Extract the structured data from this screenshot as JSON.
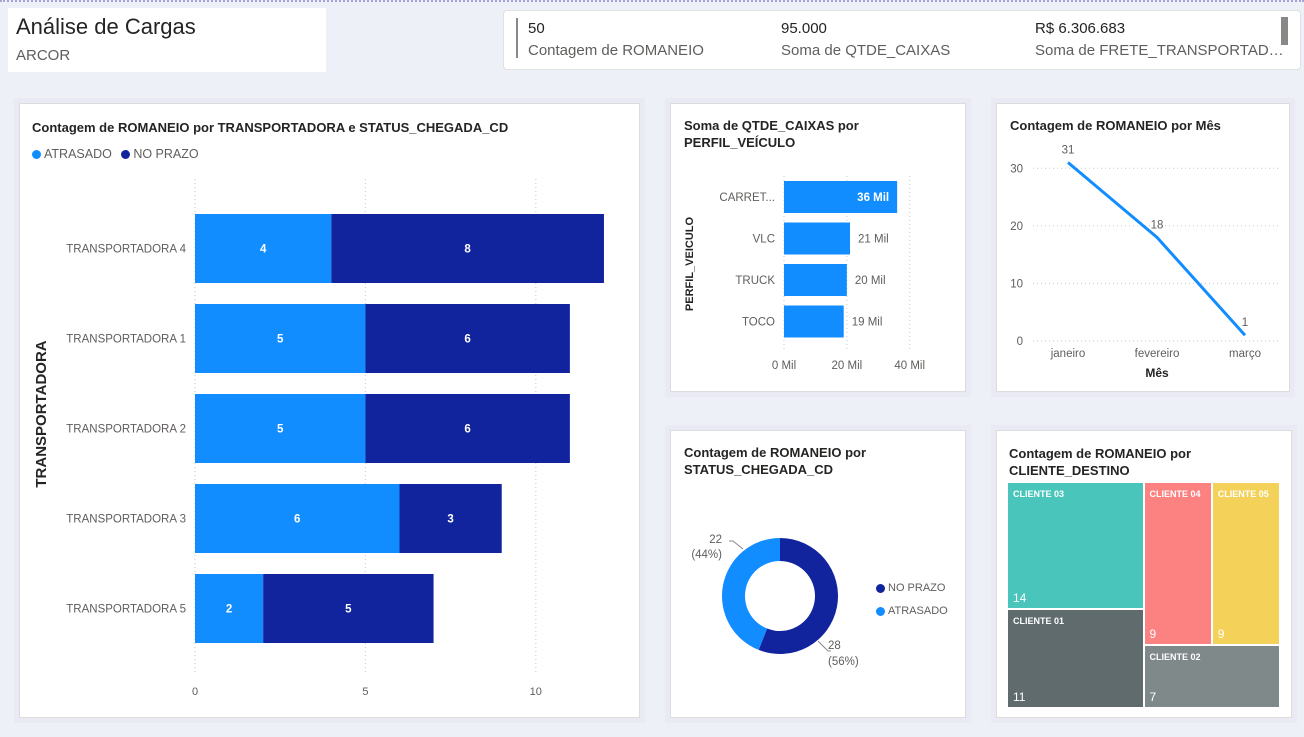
{
  "header": {
    "title": "Análise de Cargas",
    "subtitle": "ARCOR"
  },
  "kpis": [
    {
      "value": "50",
      "label": "Contagem de ROMANEIO"
    },
    {
      "value": "95.000",
      "label": "Soma de QTDE_CAIXAS"
    },
    {
      "value": "R$ 6.306.683",
      "label": "Soma de FRETE_TRANSPORTADORA"
    }
  ],
  "colors": {
    "atrasado": "#118dff",
    "no_prazo": "#12239e",
    "line": "#118dff"
  },
  "chart_data": [
    {
      "id": "bar_transportadora",
      "type": "bar",
      "orientation": "horizontal",
      "stacked": true,
      "title": "Contagem de ROMANEIO por TRANSPORTADORA e STATUS_CHEGADA_CD",
      "ylabel": "TRANSPORTADORA",
      "xlabel": "",
      "categories": [
        "TRANSPORTADORA 4",
        "TRANSPORTADORA 1",
        "TRANSPORTADORA 2",
        "TRANSPORTADORA 3",
        "TRANSPORTADORA 5"
      ],
      "series": [
        {
          "name": "ATRASADO",
          "values": [
            4,
            5,
            5,
            6,
            2
          ]
        },
        {
          "name": "NO PRAZO",
          "values": [
            8,
            6,
            6,
            3,
            5
          ]
        }
      ],
      "xticks": [
        "0",
        "5",
        "10"
      ],
      "xlim": [
        0,
        12.5
      ],
      "legend": "top-left",
      "grid": true
    },
    {
      "id": "bar_perfil",
      "type": "bar",
      "orientation": "horizontal",
      "title": "Soma de QTDE_CAIXAS por PERFIL_VEÍCULO",
      "ylabel": "PERFIL_VEICULO",
      "categories": [
        "CARRET...",
        "VLC",
        "TRUCK",
        "TOCO"
      ],
      "values": [
        36,
        21,
        20,
        19
      ],
      "value_labels": [
        "36 Mil",
        "21 Mil",
        "20 Mil",
        "19 Mil"
      ],
      "xticks": [
        "0 Mil",
        "20 Mil",
        "40 Mil"
      ],
      "xlim": [
        0,
        42
      ]
    },
    {
      "id": "line_mes",
      "type": "line",
      "title": "Contagem de ROMANEIO por Mês",
      "xlabel": "Mês",
      "x": [
        "janeiro",
        "fevereiro",
        "março"
      ],
      "values": [
        31,
        18,
        1
      ],
      "value_labels": [
        "31",
        "18",
        "1"
      ],
      "yticks": [
        "0",
        "10",
        "20",
        "30"
      ],
      "ylim": [
        0,
        33
      ],
      "grid": true
    },
    {
      "id": "donut_status",
      "type": "pie",
      "donut": true,
      "title": "Contagem de ROMANEIO por STATUS_CHEGADA_CD",
      "slices": [
        {
          "name": "NO PRAZO",
          "value": 28,
          "label": "28",
          "pct": "(56%)"
        },
        {
          "name": "ATRASADO",
          "value": 22,
          "label": "22",
          "pct": "(44%)"
        }
      ],
      "legend": "right"
    },
    {
      "id": "treemap_cliente",
      "type": "treemap",
      "title": "Contagem de ROMANEIO por CLIENTE_DESTINO",
      "items": [
        {
          "name": "CLIENTE 03",
          "value": 14,
          "color": "#4ac5bb"
        },
        {
          "name": "CLIENTE 01",
          "value": 11,
          "color": "#5f6b6d"
        },
        {
          "name": "CLIENTE 04",
          "value": 9,
          "color": "#fb8281"
        },
        {
          "name": "CLIENTE 05",
          "value": 9,
          "color": "#f4d25a"
        },
        {
          "name": "CLIENTE 02",
          "value": 7,
          "color": "#7f898a"
        }
      ]
    }
  ]
}
